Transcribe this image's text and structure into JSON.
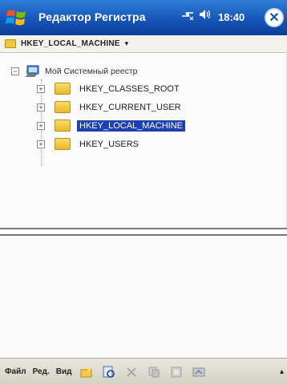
{
  "titlebar": {
    "title": "Редактор Регистра",
    "time": "18:40",
    "close_glyph": "✕"
  },
  "pathbar": {
    "path": "HKEY_LOCAL_MACHINE",
    "arrow": "▾"
  },
  "tree": {
    "root_label": "Мой Системный реестр",
    "root_expander": "−",
    "items": [
      {
        "label": "HKEY_CLASSES_ROOT",
        "expander": "+",
        "selected": false
      },
      {
        "label": "HKEY_CURRENT_USER",
        "expander": "+",
        "selected": false
      },
      {
        "label": "HKEY_LOCAL_MACHINE",
        "expander": "+",
        "selected": true
      },
      {
        "label": "HKEY_USERS",
        "expander": "+",
        "selected": false
      }
    ]
  },
  "menubar": {
    "file": "Файл",
    "edit": "Ред.",
    "view": "Вид",
    "kbd_arrow": "▴"
  },
  "colors": {
    "title_bg": "#1552b5",
    "selection": "#1d3fb0",
    "folder": "#eab82a"
  }
}
